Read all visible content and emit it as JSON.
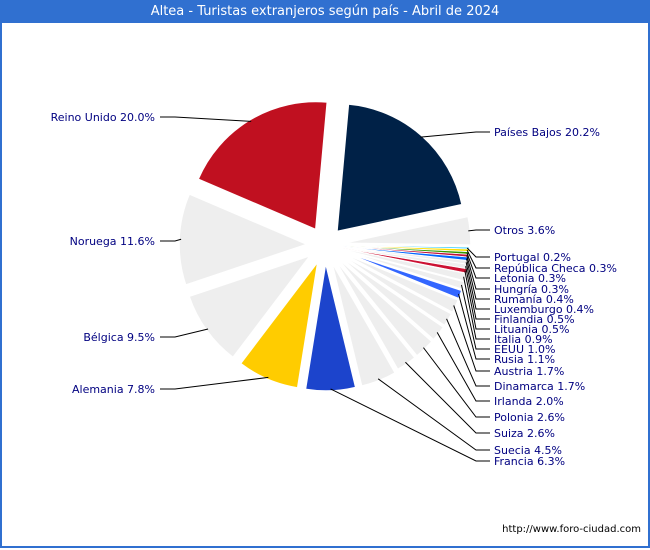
{
  "window": {
    "title": "Altea - Turistas extranjeros según país - Abril de 2024"
  },
  "footer": {
    "url_text": "http://www.foro-ciudad.com"
  },
  "colors": {
    "titlebar": "#3070d0",
    "label_text": "#000080"
  },
  "chart_data": {
    "type": "pie",
    "title": "Altea - Turistas extranjeros según país - Abril de 2024",
    "exploded": true,
    "direction": "clockwise",
    "unit": "%",
    "slices": [
      {
        "label": "Países Bajos",
        "value": 20.2,
        "color": "#002147"
      },
      {
        "label": "Otros",
        "value": 3.6,
        "color": "#eeeeee"
      },
      {
        "label": "Portugal",
        "value": 0.2,
        "color": "#33ccff"
      },
      {
        "label": "República Checa",
        "value": 0.3,
        "color": "#ffdd00"
      },
      {
        "label": "Letonia",
        "value": 0.3,
        "color": "#339900"
      },
      {
        "label": "Hungría",
        "value": 0.3,
        "color": "#c0103a"
      },
      {
        "label": "Rumanía",
        "value": 0.4,
        "color": "#0066ff"
      },
      {
        "label": "Luxemburgo",
        "value": 0.4,
        "color": "#eeeeee"
      },
      {
        "label": "Finlandia",
        "value": 0.5,
        "color": "#eeeeee"
      },
      {
        "label": "Lituania",
        "value": 0.5,
        "color": "#cc1133"
      },
      {
        "label": "Italia",
        "value": 0.9,
        "color": "#eeeeee"
      },
      {
        "label": "EEUU",
        "value": 1.0,
        "color": "#eeeeee"
      },
      {
        "label": "Rusia",
        "value": 1.1,
        "color": "#3366ff"
      },
      {
        "label": "Austria",
        "value": 1.7,
        "color": "#eeeeee"
      },
      {
        "label": "Dinamarca",
        "value": 1.7,
        "color": "#eeeeee"
      },
      {
        "label": "Irlanda",
        "value": 2.0,
        "color": "#eeeeee"
      },
      {
        "label": "Polonia",
        "value": 2.6,
        "color": "#eeeeee"
      },
      {
        "label": "Suiza",
        "value": 2.6,
        "color": "#eeeeee"
      },
      {
        "label": "Suecia",
        "value": 4.5,
        "color": "#eeeeee"
      },
      {
        "label": "Francia",
        "value": 6.3,
        "color": "#1c44cc"
      },
      {
        "label": "Alemania",
        "value": 7.8,
        "color": "#ffcc00"
      },
      {
        "label": "Bélgica",
        "value": 9.5,
        "color": "#eeeeee"
      },
      {
        "label": "Noruega",
        "value": 11.6,
        "color": "#eeeeee"
      },
      {
        "label": "Reino Unido",
        "value": 20.0,
        "color": "#c01020"
      }
    ],
    "label_texts": [
      "Países Bajos 20.2%",
      "Otros 3.6%",
      "Portugal 0.2%",
      "República Checa 0.3%",
      "Letonia 0.3%",
      "Hungría 0.3%",
      "Rumanía 0.4%",
      "Luxemburgo 0.4%",
      "Finlandia 0.5%",
      "Lituania 0.5%",
      "Italia 0.9%",
      "EEUU 1.0%",
      "Rusia 1.1%",
      "Austria 1.7%",
      "Dinamarca 1.7%",
      "Irlanda 2.0%",
      "Polonia 2.6%",
      "Suiza 2.6%",
      "Suecia 4.5%",
      "Francia 6.3%",
      "Alemania 7.8%",
      "Bélgica 9.5%",
      "Noruega 11.6%",
      "Reino Unido 20.0%"
    ]
  }
}
